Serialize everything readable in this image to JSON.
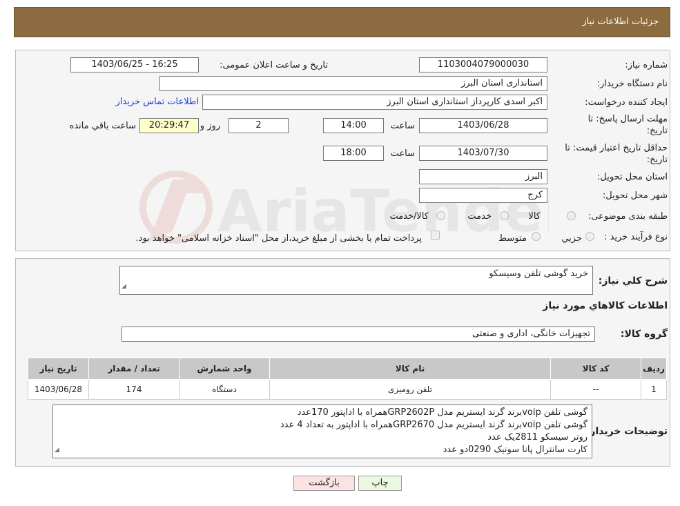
{
  "header": {
    "title": "جزئیات اطلاعات نیاز"
  },
  "need_number": {
    "label": "شماره نیاز:",
    "value": "1103004079000030"
  },
  "announce": {
    "label": "تاریخ و ساعت اعلان عمومی:",
    "value": "1403/06/25 - 16:25"
  },
  "buyer_org": {
    "label": "نام دستگاه خریدار:",
    "value": "استانداری استان البرز"
  },
  "creator": {
    "label": "ایجاد کننده درخواست:",
    "value": "اکبر اسدی کارپرداز استانداری استان البرز",
    "link": "اطلاعات تماس خریدار"
  },
  "reply_deadline": {
    "label1": "مهلت ارسال پاسخ: تا",
    "label2": "تاریخ:",
    "date": "1403/06/28",
    "time_label": "ساعت",
    "time": "14:00",
    "days": "2",
    "days_label": "روز و",
    "remaining": "20:29:47",
    "remaining_label": "ساعت باقي مانده"
  },
  "price_validity": {
    "label1": "حداقل تاریخ اعتبار قیمت: تا",
    "label2": "تاریخ:",
    "date": "1403/07/30",
    "time_label": "ساعت",
    "time": "18:00"
  },
  "province": {
    "label": "استان محل تحویل:",
    "value": "البرز"
  },
  "city": {
    "label": "شهر محل تحویل:",
    "value": "کرج"
  },
  "category": {
    "label": "طبقه بندی موضوعی:",
    "options": [
      "کالا",
      "خدمت",
      "کالا/خدمت"
    ]
  },
  "purchase_type": {
    "label": "نوع فرآیند خرید :",
    "options": [
      "جزيي",
      "متوسط"
    ],
    "note": "پرداخت تمام يا بخشی از مبلغ خريد،از محل \"اسناد خزانه اسلامی\" خواهد بود."
  },
  "watermark": "AriaTender.neT",
  "description": {
    "label": "شرح كلي نياز:",
    "value": "خرید گوشی تلفن  وسیسکو"
  },
  "goods_info": {
    "title": "اطلاعات كالاهاي مورد نياز"
  },
  "goods_group": {
    "label": "گروه کالا:",
    "value": "تجهیزات خانگی، اداری و صنعتی"
  },
  "table": {
    "headers": [
      "رديف",
      "کد کالا",
      "نام کالا",
      "واحد شمارش",
      "تعداد / مقدار",
      "تاریخ نیاز"
    ],
    "rows": [
      [
        "1",
        "--",
        "تلفن رومیزی",
        "دستگاه",
        "174",
        "1403/06/28"
      ]
    ]
  },
  "buyer_notes": {
    "label": "توضیحات خریدار:",
    "lines": [
      "گوشی تلفن voipبرند گرند ایستریم مدل GRP2602Pهمراه با اداپتور 170عدد",
      "گوشی تلفن voipبرند گرند ایستریم مدل GRP2670همراه با اداپتور به تعداد 4 عدد",
      "روتر سیسکو 2811یک عدد",
      "کارت سانترال پانا سونیک 0290دو عدد"
    ]
  },
  "buttons": {
    "print": "چاپ",
    "back": "بازگشت"
  }
}
